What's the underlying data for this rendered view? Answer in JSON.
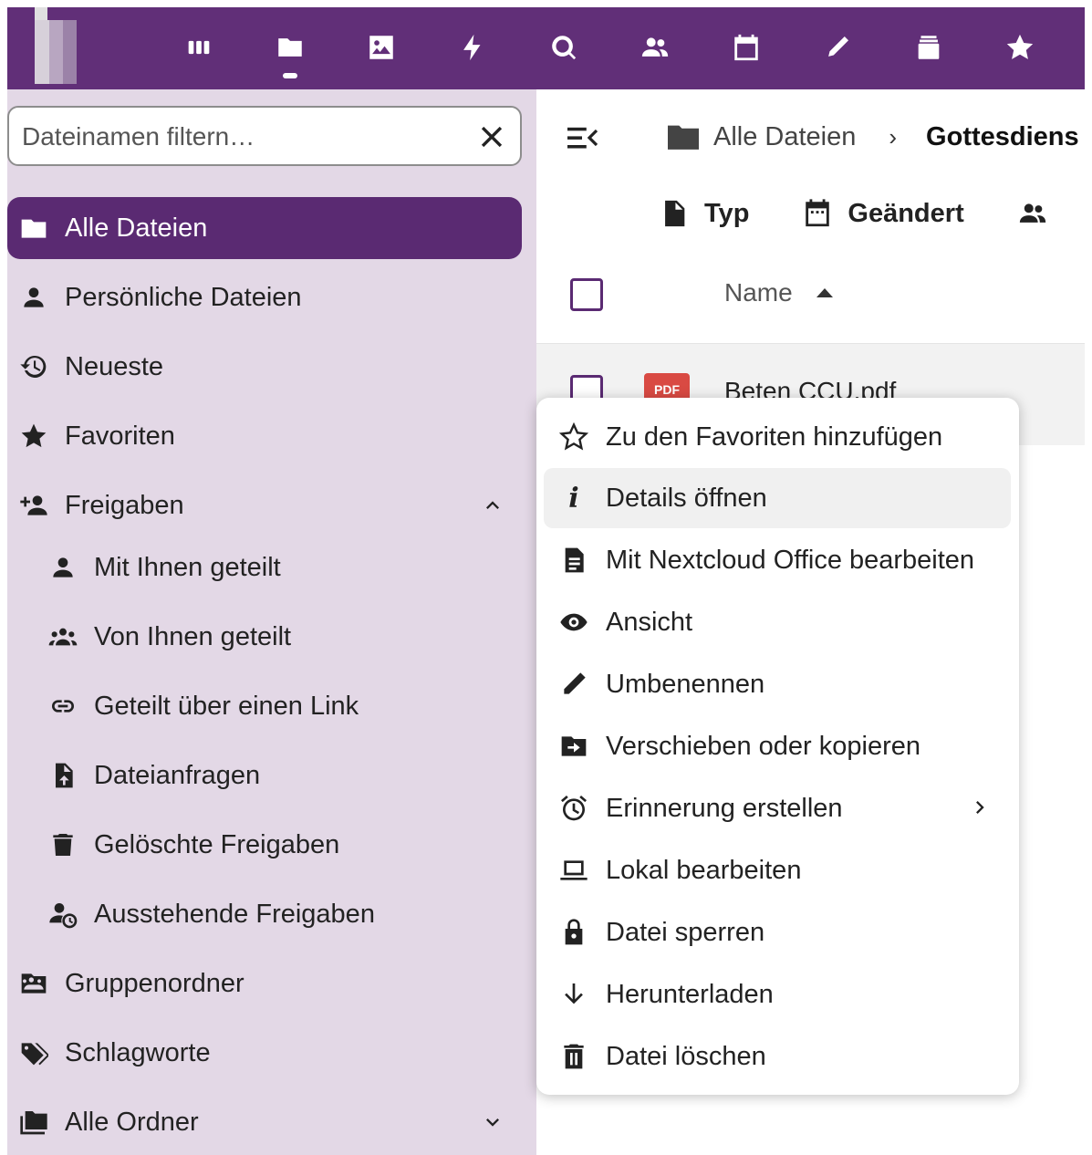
{
  "topbar": {
    "apps": [
      {
        "icon": "dashboard-icon"
      },
      {
        "icon": "files-icon",
        "active": true
      },
      {
        "icon": "photos-icon"
      },
      {
        "icon": "activity-icon"
      },
      {
        "icon": "search-icon"
      },
      {
        "icon": "contacts-icon"
      },
      {
        "icon": "calendar-icon"
      },
      {
        "icon": "notes-icon"
      },
      {
        "icon": "deck-icon"
      },
      {
        "icon": "favorites-icon"
      }
    ],
    "colors": {
      "background": "#612f78"
    }
  },
  "sidebar": {
    "filter_placeholder": "Dateinamen filtern…",
    "items": [
      {
        "label": "Alle Dateien",
        "icon": "folder-icon",
        "active": true
      },
      {
        "label": "Persönliche Dateien",
        "icon": "person-icon"
      },
      {
        "label": "Neueste",
        "icon": "history-icon"
      },
      {
        "label": "Favoriten",
        "icon": "star-icon"
      },
      {
        "label": "Freigaben",
        "icon": "share-add-icon",
        "expanded": true
      },
      {
        "label": "Mit Ihnen geteilt",
        "icon": "person-icon"
      },
      {
        "label": "Von Ihnen geteilt",
        "icon": "group-icon"
      },
      {
        "label": "Geteilt über einen Link",
        "icon": "link-icon"
      },
      {
        "label": "Dateianfragen",
        "icon": "file-upload-icon"
      },
      {
        "label": "Gelöschte Freigaben",
        "icon": "trash-icon"
      },
      {
        "label": "Ausstehende Freigaben",
        "icon": "pending-share-icon"
      },
      {
        "label": "Gruppenordner",
        "icon": "group-folder-icon"
      },
      {
        "label": "Schlagworte",
        "icon": "tags-icon"
      },
      {
        "label": "Alle Ordner",
        "icon": "folders-icon",
        "expanded": false
      }
    ]
  },
  "main": {
    "breadcrumbs": [
      "Alle Dateien",
      "Gottesdiens"
    ],
    "filters": [
      {
        "label": "Typ",
        "icon": "file-icon"
      },
      {
        "label": "Geändert",
        "icon": "calendar-icon"
      },
      {
        "label": "",
        "icon": "people-icon"
      }
    ],
    "columns": {
      "name": "Name"
    },
    "files": [
      {
        "name": "Beten CCU.pdf",
        "type_badge": "PDF"
      }
    ]
  },
  "context_menu": {
    "items": [
      {
        "label": "Zu den Favoriten hinzufügen",
        "icon": "star-outline-icon"
      },
      {
        "label": "Details öffnen",
        "icon": "info-icon",
        "hovered": true
      },
      {
        "label": "Mit Nextcloud Office bearbeiten",
        "icon": "document-icon"
      },
      {
        "label": "Ansicht",
        "icon": "eye-icon"
      },
      {
        "label": "Umbenennen",
        "icon": "pencil-icon"
      },
      {
        "label": "Verschieben oder kopieren",
        "icon": "folder-move-icon"
      },
      {
        "label": "Erinnerung erstellen",
        "icon": "alarm-icon",
        "submenu": true
      },
      {
        "label": "Lokal bearbeiten",
        "icon": "laptop-icon"
      },
      {
        "label": "Datei sperren",
        "icon": "lock-icon"
      },
      {
        "label": "Herunterladen",
        "icon": "download-icon"
      },
      {
        "label": "Datei löschen",
        "icon": "delete-icon"
      }
    ]
  }
}
